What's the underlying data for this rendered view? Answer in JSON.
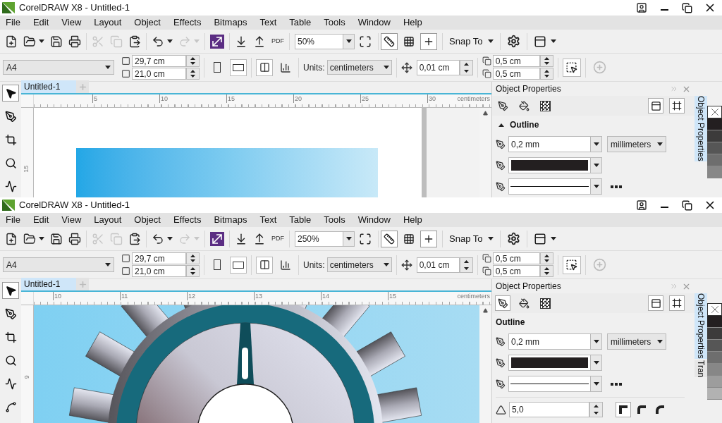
{
  "windows": [
    {
      "title": "CorelDRAW X8 - Untitled-1",
      "menu": [
        "File",
        "Edit",
        "View",
        "Layout",
        "Object",
        "Effects",
        "Bitmaps",
        "Text",
        "Table",
        "Tools",
        "Window",
        "Help"
      ],
      "toolbar": [
        {
          "kind": "new",
          "disabled": false
        },
        {
          "kind": "open",
          "disabled": false
        },
        {
          "kind": "save",
          "disabled": false
        },
        {
          "kind": "print",
          "disabled": false
        },
        {
          "kind": "cut",
          "disabled": true
        },
        {
          "kind": "copy",
          "disabled": true
        },
        {
          "kind": "paste",
          "disabled": false
        },
        {
          "kind": "undo",
          "disabled": false
        },
        {
          "kind": "redo",
          "disabled": true
        },
        {
          "kind": "launch",
          "disabled": false
        },
        {
          "kind": "import",
          "disabled": false
        },
        {
          "kind": "export",
          "disabled": false
        },
        {
          "kind": "pdf",
          "disabled": false,
          "label": "PDF"
        }
      ],
      "zoom_level": "50%",
      "view_toggles": [
        {
          "kind": "rulers",
          "on": true
        },
        {
          "kind": "grid",
          "on": false
        },
        {
          "kind": "guidelines",
          "on": true
        }
      ],
      "snap_label": "Snap To",
      "page_size": "A4",
      "page_width": "29,7 cm",
      "page_height": "21,0 cm",
      "units_label": "Units:",
      "units": "centimeters",
      "nudge": "0,01 cm",
      "duplicate_x": "0,5 cm",
      "duplicate_y": "0,5 cm",
      "tools": [
        {
          "kind": "pick",
          "selected": true
        },
        {
          "kind": "shape",
          "selected": false
        },
        {
          "kind": "crop",
          "selected": false
        },
        {
          "kind": "zoom",
          "selected": false
        },
        {
          "kind": "freehand",
          "selected": false
        }
      ],
      "document_tab": "Untitled-1",
      "ruler": {
        "marks": [
          "5",
          "10",
          "15",
          "20",
          "25",
          "30"
        ],
        "unit": "centimeters",
        "vertical_marks": [
          "15"
        ]
      },
      "canvas": {
        "kind": "page"
      },
      "panel": {
        "title": "Object Properties",
        "tabs": [
          {
            "kind": "outline",
            "selected": false
          },
          {
            "kind": "fill",
            "selected": false
          },
          {
            "kind": "transparency",
            "selected": false
          }
        ],
        "section": "Outline",
        "expander": true,
        "width": "0,2 mm",
        "width_units": "millimeters"
      },
      "docker_tabs": [
        "Object Properties"
      ],
      "palette": [
        {
          "kind": "none"
        },
        {
          "kind": "swatch",
          "color": "#231f20"
        },
        {
          "kind": "swatch",
          "color": "#3c3b3b"
        },
        {
          "kind": "swatch",
          "color": "#565656"
        },
        {
          "kind": "swatch",
          "color": "#6e6e6e"
        },
        {
          "kind": "swatch",
          "color": "#878787"
        }
      ]
    },
    {
      "title": "CorelDRAW X8 - Untitled-1",
      "menu": [
        "File",
        "Edit",
        "View",
        "Layout",
        "Object",
        "Effects",
        "Bitmaps",
        "Text",
        "Table",
        "Tools",
        "Window",
        "Help"
      ],
      "toolbar": [
        {
          "kind": "new",
          "disabled": false
        },
        {
          "kind": "open",
          "disabled": false
        },
        {
          "kind": "save",
          "disabled": false
        },
        {
          "kind": "print",
          "disabled": false
        },
        {
          "kind": "cut",
          "disabled": true
        },
        {
          "kind": "copy",
          "disabled": true
        },
        {
          "kind": "paste",
          "disabled": false
        },
        {
          "kind": "undo",
          "disabled": false
        },
        {
          "kind": "redo",
          "disabled": true
        },
        {
          "kind": "launch",
          "disabled": false
        },
        {
          "kind": "import",
          "disabled": false
        },
        {
          "kind": "export",
          "disabled": false
        },
        {
          "kind": "pdf",
          "disabled": false,
          "label": "PDF"
        }
      ],
      "zoom_level": "250%",
      "view_toggles": [
        {
          "kind": "rulers",
          "on": true
        },
        {
          "kind": "grid",
          "on": false
        },
        {
          "kind": "guidelines",
          "on": true
        }
      ],
      "snap_label": "Snap To",
      "page_size": "A4",
      "page_width": "29,7 cm",
      "page_height": "21,0 cm",
      "units_label": "Units:",
      "units": "centimeters",
      "nudge": "0,01 cm",
      "duplicate_x": "0,5 cm",
      "duplicate_y": "0,5 cm",
      "tools": [
        {
          "kind": "pick",
          "selected": true
        },
        {
          "kind": "shape",
          "selected": false
        },
        {
          "kind": "crop",
          "selected": false
        },
        {
          "kind": "zoom",
          "selected": false
        },
        {
          "kind": "freehand",
          "selected": false
        },
        {
          "kind": "artistic",
          "selected": false
        }
      ],
      "document_tab": "Untitled-1",
      "ruler": {
        "marks": [
          "10",
          "11",
          "12",
          "13",
          "14",
          "15"
        ],
        "unit": "centimeters",
        "vertical_marks": [
          "9"
        ]
      },
      "canvas": {
        "kind": "gear"
      },
      "panel": {
        "title": "Object Properties",
        "tabs": [
          {
            "kind": "outline",
            "selected": true
          },
          {
            "kind": "fill",
            "selected": false
          },
          {
            "kind": "transparency",
            "selected": false
          }
        ],
        "section": "Outline",
        "expander": false,
        "width": "0,2 mm",
        "width_units": "millimeters",
        "miter_limit": "5,0"
      },
      "docker_tabs": [
        "Object Properties",
        "Tran"
      ],
      "palette": [
        {
          "kind": "none"
        },
        {
          "kind": "swatch",
          "color": "#231f20"
        },
        {
          "kind": "swatch",
          "color": "#3c3b3b"
        },
        {
          "kind": "swatch",
          "color": "#565656"
        },
        {
          "kind": "swatch",
          "color": "#6e6e6e"
        },
        {
          "kind": "swatch",
          "color": "#878787"
        },
        {
          "kind": "swatch",
          "color": "#9d9d9d"
        },
        {
          "kind": "swatch",
          "color": "#b2b2b2"
        }
      ]
    }
  ]
}
